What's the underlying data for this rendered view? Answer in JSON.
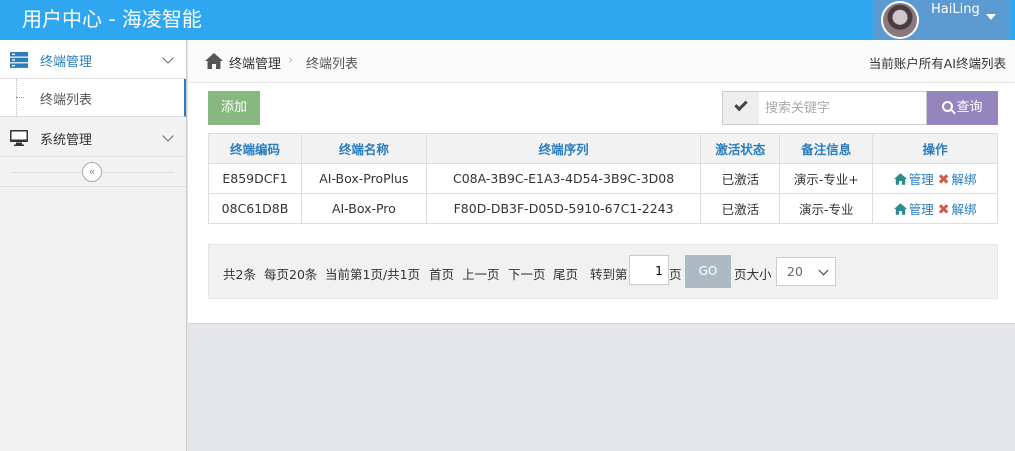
{
  "header": {
    "brand": "用户中心 - 海凌智能",
    "username": "HaiLing"
  },
  "sidebar": {
    "items": [
      {
        "label": "终端管理",
        "icon": "server-icon",
        "active": true
      },
      {
        "label": "系统管理",
        "icon": "monitor-icon",
        "active": false
      }
    ],
    "sub_items": [
      {
        "label": "终端列表"
      }
    ],
    "collapse_icon": "double-chevron-left-icon"
  },
  "breadcrumb": {
    "home": "终端管理",
    "current": "终端列表",
    "right_note": "当前账户所有AI终端列表"
  },
  "toolbar": {
    "add_label": "添加",
    "search_placeholder": "搜索关键字",
    "search_value": "",
    "search_label": "查询"
  },
  "table": {
    "columns": [
      "终端编码",
      "终端名称",
      "终端序列",
      "激活状态",
      "备注信息",
      "操作"
    ],
    "rows": [
      {
        "code": "E859DCF1",
        "name": "AI-Box-ProPlus",
        "serial": "C08A-3B9C-E1A3-4D54-3B9C-3D08",
        "status": "已激活",
        "note": "演示-专业+",
        "manage": "管理",
        "unbind": "解绑"
      },
      {
        "code": "08C61D8B",
        "name": "AI-Box-Pro",
        "serial": "F80D-DB3F-D05D-5910-67C1-2243",
        "status": "已激活",
        "note": "演示-专业",
        "manage": "管理",
        "unbind": "解绑"
      }
    ]
  },
  "pager": {
    "total": "共2条",
    "per_page": "每页20条",
    "current": "当前第1页/共1页",
    "first": "首页",
    "prev": "上一页",
    "next": "下一页",
    "last": "尾页",
    "goto_prefix": "转到第",
    "goto_value": "1",
    "goto_suffix": "页",
    "go_label": "GO",
    "size_label": "页大小",
    "size_value": "20"
  },
  "colors": {
    "topbar": "#2fa6f0",
    "user_area": "#5b9bd1",
    "add_button": "#87b87f",
    "search_button": "#9585bf",
    "go_button": "#abbac3",
    "link": "#2b7dbc",
    "unbind_x": "#d15b47"
  }
}
